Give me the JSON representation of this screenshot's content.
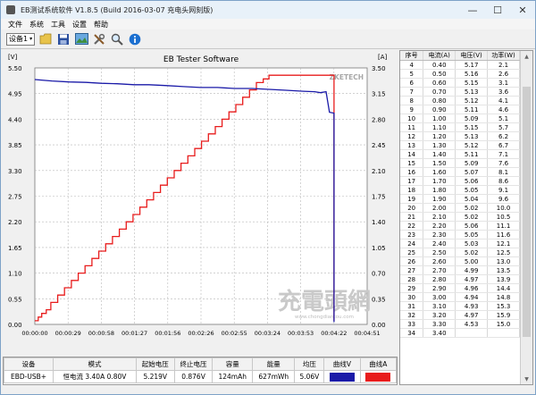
{
  "window": {
    "title": "EB测试系统软件 V1.8.5 (Build 2016-03-07 充电头网刻版)",
    "minimize_glyph": "—",
    "maximize_glyph": "☐",
    "close_glyph": "✕"
  },
  "menu": [
    "文件",
    "系统",
    "工具",
    "设置",
    "帮助"
  ],
  "toolbar": {
    "device_selector": "设备1"
  },
  "chart": {
    "title": "EB Tester Software",
    "left_unit": "[V]",
    "right_unit": "[A]",
    "corner_mark": "ZKETECH",
    "watermark": "充電頭網",
    "watermark_url": "www.chongdiantou.com",
    "colors": {
      "voltage": "#1a1aa8",
      "current": "#e81c1c"
    }
  },
  "chart_data": {
    "type": "line",
    "x_labels": [
      "00:00:00",
      "00:00:29",
      "00:00:58",
      "00:01:27",
      "00:01:56",
      "00:02:26",
      "00:02:55",
      "00:03:24",
      "00:03:53",
      "00:04:22",
      "00:04:51"
    ],
    "xlim_seconds": [
      0,
      291
    ],
    "y_left": {
      "label": "[V]",
      "ylim": [
        0,
        5.5
      ],
      "ticks": [
        "0.00",
        "0.55",
        "1.10",
        "1.65",
        "2.20",
        "2.75",
        "3.30",
        "3.85",
        "4.40",
        "4.95",
        "5.50"
      ]
    },
    "y_right": {
      "label": "[A]",
      "ylim": [
        0,
        3.5
      ],
      "ticks": [
        "0.00",
        "0.35",
        "0.70",
        "1.05",
        "1.40",
        "1.75",
        "2.10",
        "2.45",
        "2.80",
        "3.15",
        "3.50"
      ]
    },
    "grid": true,
    "series": [
      {
        "axis": "left",
        "color": "#1a1aa8",
        "points": [
          [
            0,
            5.25
          ],
          [
            15,
            5.22
          ],
          [
            30,
            5.2
          ],
          [
            45,
            5.19
          ],
          [
            58,
            5.17
          ],
          [
            72,
            5.16
          ],
          [
            87,
            5.14
          ],
          [
            100,
            5.14
          ],
          [
            116,
            5.12
          ],
          [
            130,
            5.1
          ],
          [
            145,
            5.08
          ],
          [
            160,
            5.08
          ],
          [
            175,
            5.06
          ],
          [
            190,
            5.06
          ],
          [
            205,
            5.04
          ],
          [
            220,
            5.02
          ],
          [
            235,
            5.0
          ],
          [
            245,
            4.99
          ],
          [
            250,
            4.97
          ],
          [
            255,
            4.99
          ],
          [
            258,
            4.55
          ],
          [
            262,
            4.53
          ],
          [
            262,
            0.05
          ]
        ]
      },
      {
        "axis": "right",
        "color": "#e81c1c",
        "points": [
          [
            0,
            0.05
          ],
          [
            3,
            0.1
          ],
          [
            6,
            0.15
          ],
          [
            10,
            0.2
          ],
          [
            14,
            0.3
          ],
          [
            20,
            0.4
          ],
          [
            26,
            0.5
          ],
          [
            32,
            0.6
          ],
          [
            38,
            0.7
          ],
          [
            44,
            0.8
          ],
          [
            50,
            0.9
          ],
          [
            56,
            1.0
          ],
          [
            62,
            1.1
          ],
          [
            68,
            1.2
          ],
          [
            74,
            1.3
          ],
          [
            80,
            1.4
          ],
          [
            86,
            1.5
          ],
          [
            92,
            1.6
          ],
          [
            98,
            1.7
          ],
          [
            104,
            1.8
          ],
          [
            110,
            1.9
          ],
          [
            116,
            2.0
          ],
          [
            122,
            2.1
          ],
          [
            128,
            2.2
          ],
          [
            134,
            2.3
          ],
          [
            140,
            2.4
          ],
          [
            146,
            2.5
          ],
          [
            152,
            2.6
          ],
          [
            158,
            2.7
          ],
          [
            164,
            2.8
          ],
          [
            170,
            2.9
          ],
          [
            176,
            3.0
          ],
          [
            182,
            3.1
          ],
          [
            188,
            3.2
          ],
          [
            194,
            3.3
          ],
          [
            200,
            3.35
          ],
          [
            205,
            3.4
          ],
          [
            210,
            3.4
          ],
          [
            215,
            3.4
          ],
          [
            255,
            3.4
          ],
          [
            262,
            3.4
          ],
          [
            262,
            0.05
          ]
        ]
      }
    ]
  },
  "table": {
    "headers": [
      "序号",
      "电流(A)",
      "电压(V)",
      "功率(W)"
    ],
    "rows": [
      [
        "4",
        "0.40",
        "5.17",
        "2.1"
      ],
      [
        "5",
        "0.50",
        "5.16",
        "2.6"
      ],
      [
        "6",
        "0.60",
        "5.15",
        "3.1"
      ],
      [
        "7",
        "0.70",
        "5.13",
        "3.6"
      ],
      [
        "8",
        "0.80",
        "5.12",
        "4.1"
      ],
      [
        "9",
        "0.90",
        "5.11",
        "4.6"
      ],
      [
        "10",
        "1.00",
        "5.09",
        "5.1"
      ],
      [
        "11",
        "1.10",
        "5.15",
        "5.7"
      ],
      [
        "12",
        "1.20",
        "5.13",
        "6.2"
      ],
      [
        "13",
        "1.30",
        "5.12",
        "6.7"
      ],
      [
        "14",
        "1.40",
        "5.11",
        "7.1"
      ],
      [
        "15",
        "1.50",
        "5.09",
        "7.6"
      ],
      [
        "16",
        "1.60",
        "5.07",
        "8.1"
      ],
      [
        "17",
        "1.70",
        "5.06",
        "8.6"
      ],
      [
        "18",
        "1.80",
        "5.05",
        "9.1"
      ],
      [
        "19",
        "1.90",
        "5.04",
        "9.6"
      ],
      [
        "20",
        "2.00",
        "5.02",
        "10.0"
      ],
      [
        "21",
        "2.10",
        "5.02",
        "10.5"
      ],
      [
        "22",
        "2.20",
        "5.06",
        "11.1"
      ],
      [
        "23",
        "2.30",
        "5.05",
        "11.6"
      ],
      [
        "24",
        "2.40",
        "5.03",
        "12.1"
      ],
      [
        "25",
        "2.50",
        "5.02",
        "12.5"
      ],
      [
        "26",
        "2.60",
        "5.00",
        "13.0"
      ],
      [
        "27",
        "2.70",
        "4.99",
        "13.5"
      ],
      [
        "28",
        "2.80",
        "4.97",
        "13.9"
      ],
      [
        "29",
        "2.90",
        "4.96",
        "14.4"
      ],
      [
        "30",
        "3.00",
        "4.94",
        "14.8"
      ],
      [
        "31",
        "3.10",
        "4.93",
        "15.3"
      ],
      [
        "32",
        "3.20",
        "4.97",
        "15.9"
      ],
      [
        "33",
        "3.30",
        "4.53",
        "15.0"
      ],
      [
        "34",
        "3.40",
        "",
        ""
      ]
    ]
  },
  "summary": {
    "headers": [
      "设备",
      "模式",
      "起始电压",
      "终止电压",
      "容量",
      "能量",
      "均压",
      "曲线V",
      "曲线A"
    ],
    "row": [
      "EBD-USB+",
      "恒电流  3.40A  0.80V",
      "5.219V",
      "0.876V",
      "124mAh",
      "627mWh",
      "5.06V"
    ]
  }
}
